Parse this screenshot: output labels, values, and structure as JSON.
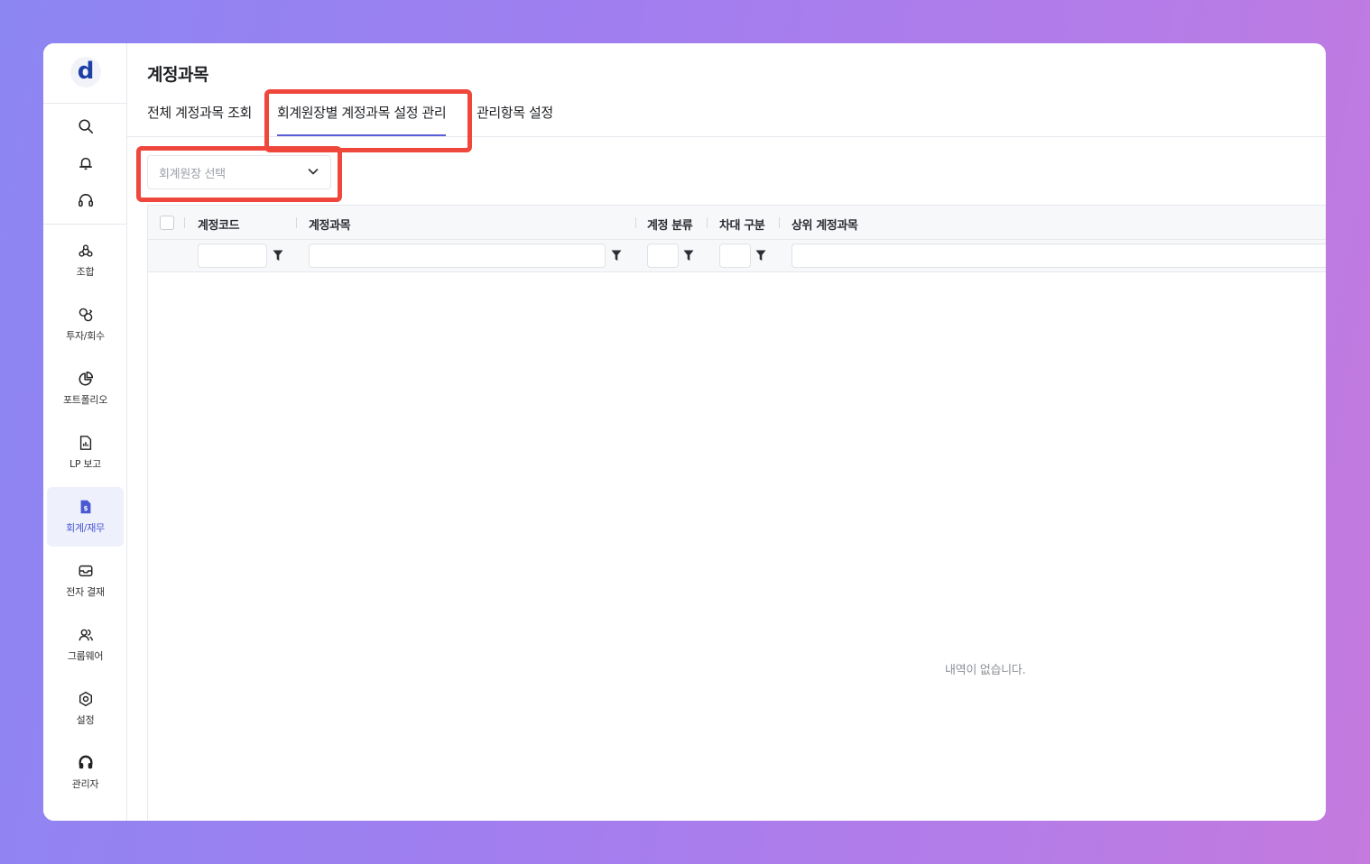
{
  "sidebar": {
    "logo": "d",
    "top_icons": [
      {
        "icon": "search-icon"
      },
      {
        "icon": "bell-icon"
      },
      {
        "icon": "headset-icon"
      }
    ],
    "items": [
      {
        "label": "조합",
        "icon": "fund-icon"
      },
      {
        "label": "투자/회수",
        "icon": "invest-icon"
      },
      {
        "label": "포트폴리오",
        "icon": "pie-chart-icon"
      },
      {
        "label": "LP 보고",
        "icon": "report-icon"
      },
      {
        "label": "회계/재무",
        "icon": "accounting-icon",
        "active": true
      },
      {
        "label": "전자 결재",
        "icon": "inbox-icon"
      },
      {
        "label": "그룹웨어",
        "icon": "users-icon"
      },
      {
        "label": "설정",
        "icon": "settings-icon"
      },
      {
        "label": "관리자",
        "icon": "admin-icon"
      }
    ]
  },
  "page": {
    "title": "계정과목",
    "tabs": [
      {
        "label": "전체 계정과목 조회"
      },
      {
        "label": "회계원장별 계정과목 설정 관리",
        "active": true
      },
      {
        "label": "관리항목 설정"
      }
    ],
    "ledger_select": {
      "placeholder": "회계원장 선택"
    }
  },
  "grid": {
    "columns": [
      "계정코드",
      "계정과목",
      "계정 분류",
      "차대 구분",
      "상위 계정과목"
    ],
    "empty_message": "내역이 없습니다."
  },
  "colors": {
    "accent": "#5b5fd6",
    "highlight": "#f0473d",
    "active_nav_bg": "#eef0fb"
  }
}
